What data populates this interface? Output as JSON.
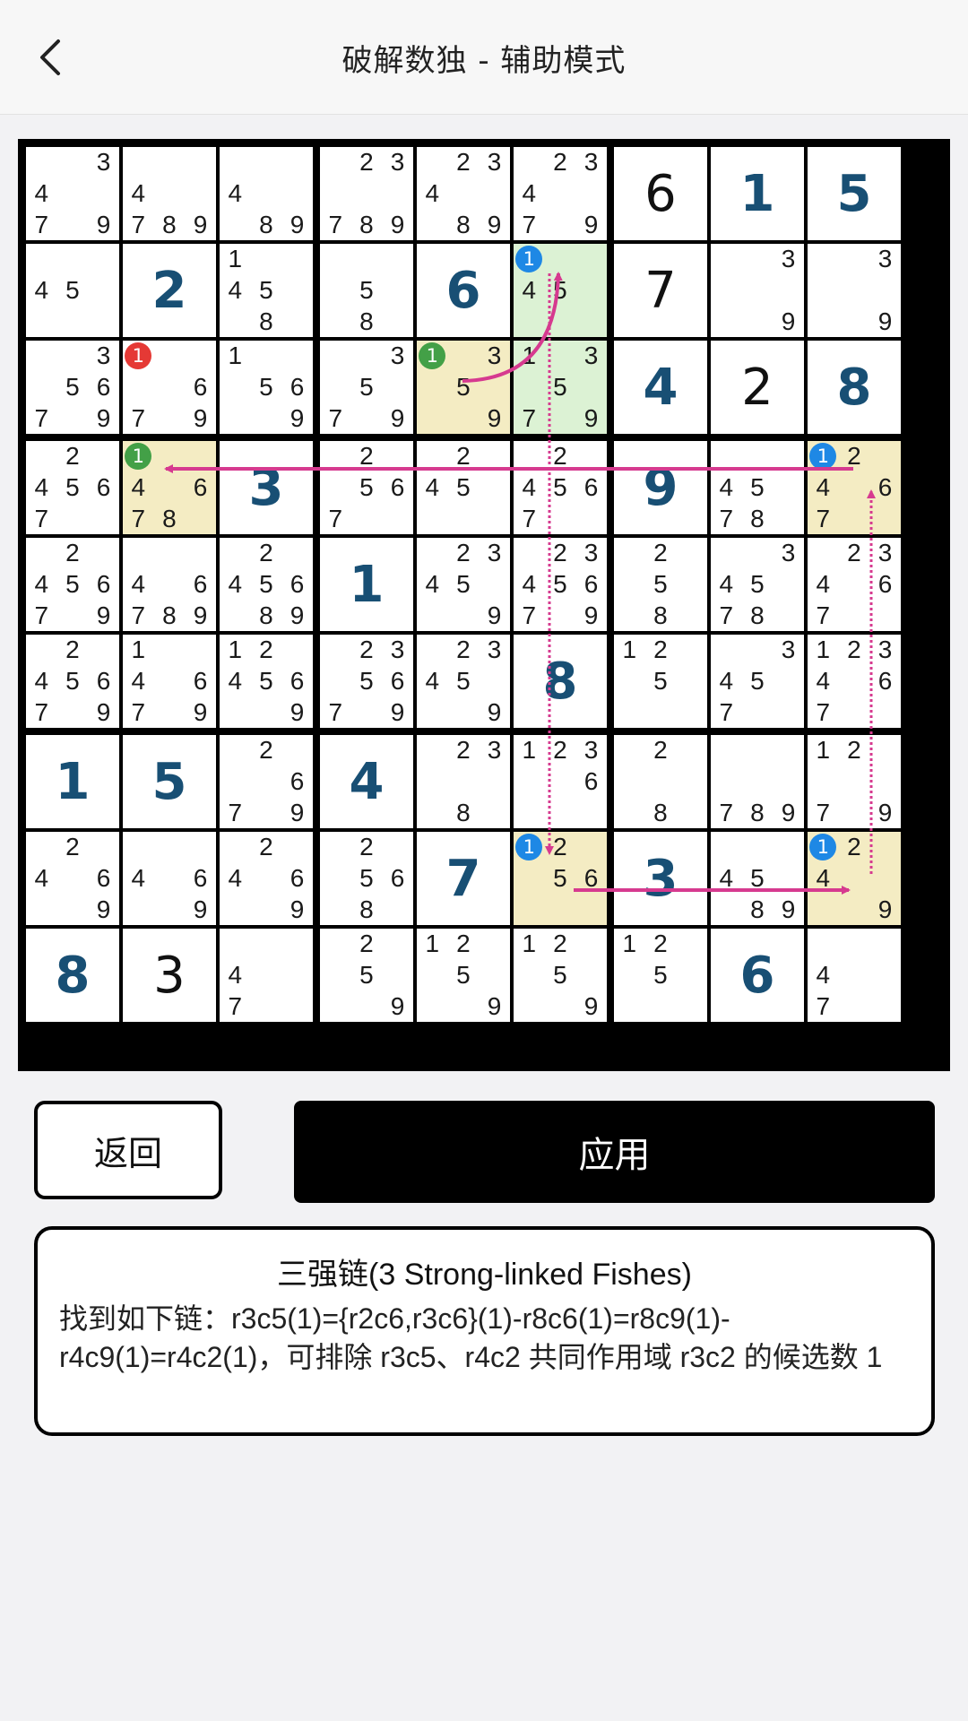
{
  "header": {
    "title": "破解数独 - 辅助模式"
  },
  "board": {
    "cells": [
      [
        {
          "c": [
            3,
            4,
            7,
            9
          ]
        },
        {
          "c": [
            4,
            7,
            8,
            9
          ]
        },
        {
          "c": [
            4,
            8,
            9
          ]
        },
        {
          "c": [
            2,
            3,
            7,
            8,
            9
          ]
        },
        {
          "c": [
            2,
            3,
            4,
            8,
            9
          ]
        },
        {
          "c": [
            2,
            3,
            4,
            7,
            9
          ]
        },
        {
          "v": 6,
          "t": "user"
        },
        {
          "v": 1,
          "t": "given"
        },
        {
          "v": 5,
          "t": "given"
        }
      ],
      [
        {
          "c": [
            4,
            5
          ]
        },
        {
          "v": 2,
          "t": "given"
        },
        {
          "c": [
            1,
            4,
            5,
            8
          ]
        },
        {
          "c": [
            5,
            8
          ]
        },
        {
          "v": 6,
          "t": "given"
        },
        {
          "c": [
            1,
            4,
            5
          ],
          "hl": "green",
          "mark": {
            "d": 1,
            "color": "#1e88e5"
          }
        },
        {
          "v": 7,
          "t": "user"
        },
        {
          "c": [
            3,
            9
          ]
        },
        {
          "c": [
            3,
            9
          ]
        }
      ],
      [
        {
          "c": [
            3,
            5,
            6,
            7,
            9
          ]
        },
        {
          "c": [
            1,
            6,
            7,
            9
          ],
          "mark": {
            "d": 1,
            "color": "#e53935"
          }
        },
        {
          "c": [
            1,
            5,
            6,
            9
          ]
        },
        {
          "c": [
            3,
            5,
            7,
            9
          ]
        },
        {
          "c": [
            1,
            3,
            5,
            9
          ],
          "hl": "yellow",
          "mark": {
            "d": 1,
            "color": "#43a047"
          }
        },
        {
          "c": [
            1,
            3,
            5,
            7,
            9
          ],
          "hl": "green"
        },
        {
          "v": 4,
          "t": "given"
        },
        {
          "v": 2,
          "t": "user"
        },
        {
          "v": 8,
          "t": "given"
        }
      ],
      [
        {
          "c": [
            2,
            4,
            5,
            6,
            7
          ]
        },
        {
          "c": [
            1,
            4,
            6,
            7,
            8
          ],
          "hl": "yellow",
          "mark": {
            "d": 1,
            "color": "#43a047"
          }
        },
        {
          "v": 3,
          "t": "given"
        },
        {
          "c": [
            2,
            5,
            6,
            7
          ]
        },
        {
          "c": [
            2,
            4,
            5
          ]
        },
        {
          "c": [
            2,
            4,
            5,
            6,
            7
          ]
        },
        {
          "v": 9,
          "t": "given"
        },
        {
          "c": [
            4,
            5,
            7,
            8
          ]
        },
        {
          "c": [
            1,
            2,
            4,
            6,
            7
          ],
          "hl": "yellow",
          "mark": {
            "d": 1,
            "color": "#1e88e5"
          }
        }
      ],
      [
        {
          "c": [
            2,
            4,
            5,
            6,
            7,
            9
          ]
        },
        {
          "c": [
            4,
            6,
            7,
            8,
            9
          ]
        },
        {
          "c": [
            2,
            4,
            5,
            6,
            8,
            9
          ]
        },
        {
          "v": 1,
          "t": "given"
        },
        {
          "c": [
            2,
            3,
            4,
            5,
            9
          ]
        },
        {
          "c": [
            2,
            3,
            4,
            5,
            6,
            7,
            9
          ]
        },
        {
          "c": [
            2,
            5,
            8
          ]
        },
        {
          "c": [
            3,
            4,
            5,
            7,
            8
          ]
        },
        {
          "c": [
            2,
            3,
            4,
            6,
            7
          ]
        }
      ],
      [
        {
          "c": [
            2,
            4,
            5,
            6,
            7,
            9
          ]
        },
        {
          "c": [
            1,
            4,
            6,
            7,
            9
          ]
        },
        {
          "c": [
            1,
            2,
            4,
            5,
            6,
            9
          ]
        },
        {
          "c": [
            2,
            3,
            5,
            6,
            7,
            9
          ]
        },
        {
          "c": [
            2,
            3,
            4,
            5,
            9
          ]
        },
        {
          "v": 8,
          "t": "given"
        },
        {
          "c": [
            1,
            2,
            5
          ]
        },
        {
          "c": [
            3,
            4,
            5,
            7
          ]
        },
        {
          "c": [
            1,
            2,
            3,
            4,
            6,
            7
          ]
        }
      ],
      [
        {
          "v": 1,
          "t": "given"
        },
        {
          "v": 5,
          "t": "given"
        },
        {
          "c": [
            2,
            6,
            7,
            9
          ]
        },
        {
          "v": 4,
          "t": "given"
        },
        {
          "c": [
            2,
            3,
            8
          ]
        },
        {
          "c": [
            1,
            2,
            3,
            6
          ]
        },
        {
          "c": [
            2,
            8
          ]
        },
        {
          "c": [
            7,
            8,
            9
          ]
        },
        {
          "c": [
            1,
            2,
            7,
            9
          ]
        }
      ],
      [
        {
          "c": [
            2,
            4,
            6,
            9
          ]
        },
        {
          "c": [
            4,
            6,
            9
          ]
        },
        {
          "c": [
            2,
            4,
            6,
            9
          ]
        },
        {
          "c": [
            2,
            5,
            6,
            8
          ]
        },
        {
          "v": 7,
          "t": "given"
        },
        {
          "c": [
            1,
            2,
            5,
            6
          ],
          "hl": "yellow",
          "mark": {
            "d": 1,
            "color": "#1e88e5"
          }
        },
        {
          "v": 3,
          "t": "given"
        },
        {
          "c": [
            4,
            5,
            8,
            9
          ]
        },
        {
          "c": [
            1,
            2,
            4,
            9
          ],
          "hl": "yellow",
          "mark": {
            "d": 1,
            "color": "#1e88e5"
          }
        }
      ],
      [
        {
          "v": 8,
          "t": "given"
        },
        {
          "v": 3,
          "t": "user"
        },
        {
          "c": [
            4,
            7
          ]
        },
        {
          "c": [
            2,
            5,
            9
          ]
        },
        {
          "c": [
            1,
            2,
            5,
            9
          ]
        },
        {
          "c": [
            1,
            2,
            5,
            9
          ]
        },
        {
          "c": [
            1,
            2,
            5
          ]
        },
        {
          "v": 6,
          "t": "given"
        },
        {
          "c": [
            4,
            7
          ]
        }
      ]
    ]
  },
  "buttons": {
    "back_label": "返回",
    "apply_label": "应用"
  },
  "info": {
    "title": "三强链(3 Strong-linked Fishes)",
    "body": "找到如下链：r3c5(1)={r2c6,r3c6}(1)-r8c6(1)=r8c9(1)-r4c9(1)=r4c2(1)，可排除 r3c5、r4c2 共同作用域 r3c2 的候选数 1"
  },
  "colors": {
    "given": "#184f74",
    "link": "#d63a8f",
    "green_hl": "#dcf2d4",
    "yellow_hl": "#f4ecc3"
  }
}
